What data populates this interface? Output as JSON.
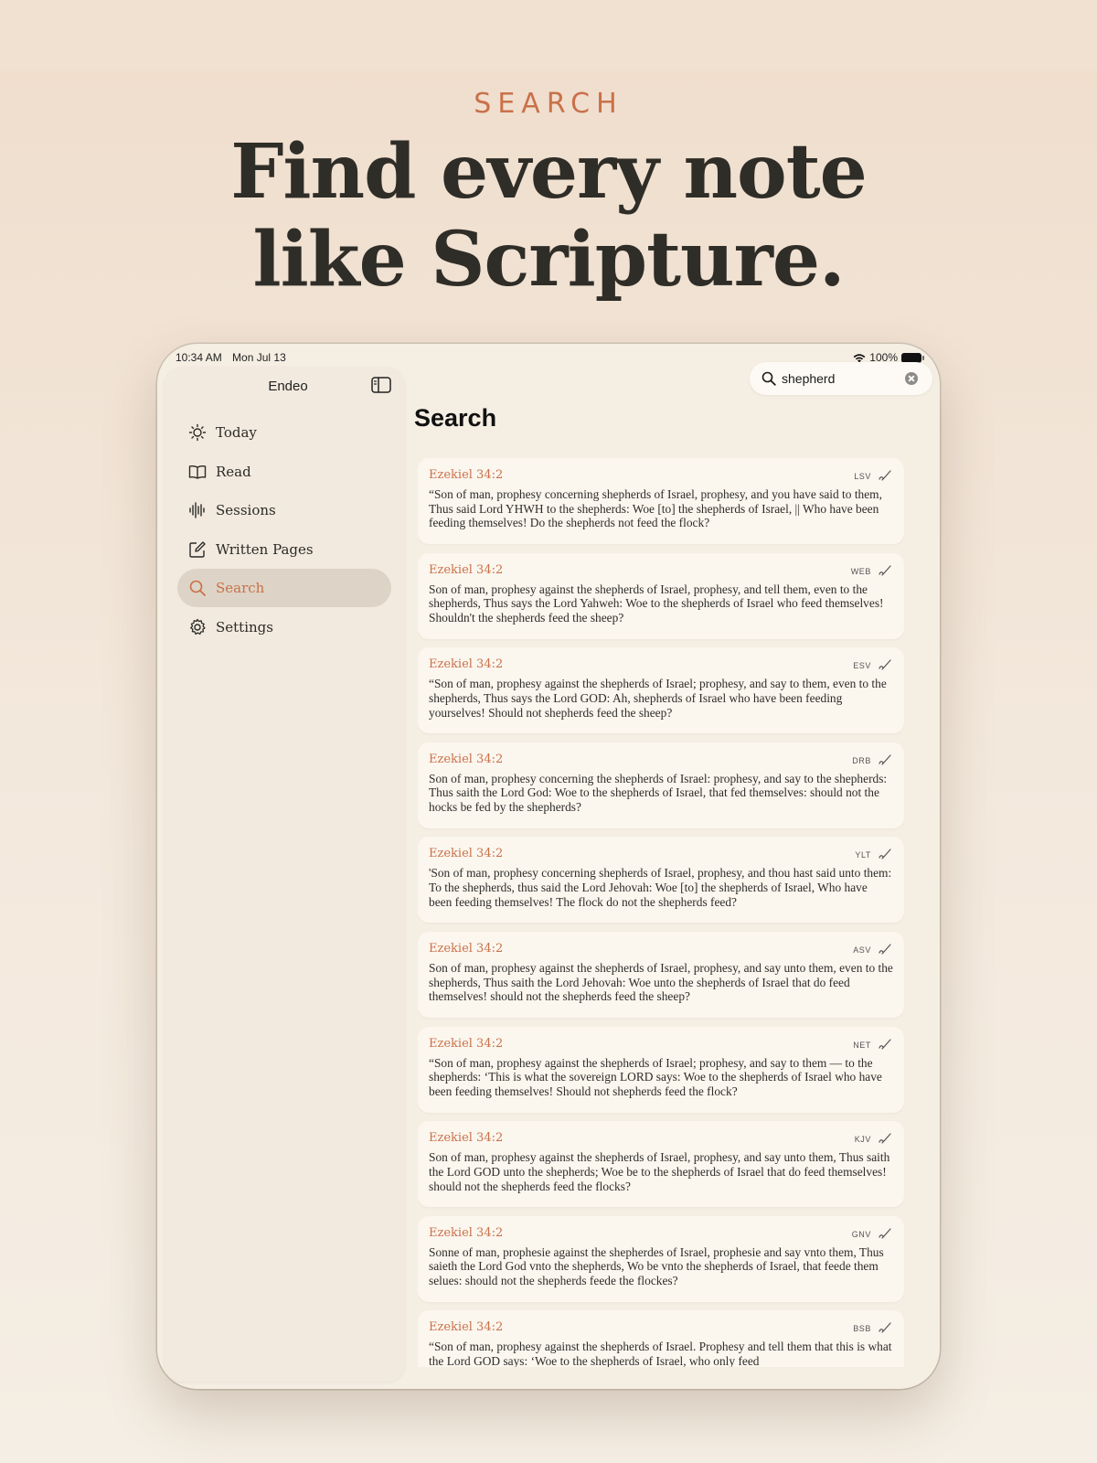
{
  "header": {
    "eyebrow": "SEARCH",
    "headline_line1": "Find every note",
    "headline_line2": "like Scripture."
  },
  "status_bar": {
    "time": "10:34 AM",
    "date": "Mon Jul 13",
    "battery": "100%"
  },
  "sidebar": {
    "app_title": "Endeo",
    "items": [
      {
        "label": "Today",
        "icon": "sun-icon"
      },
      {
        "label": "Read",
        "icon": "book-icon"
      },
      {
        "label": "Sessions",
        "icon": "waveform-icon"
      },
      {
        "label": "Written Pages",
        "icon": "compose-icon"
      },
      {
        "label": "Search",
        "icon": "search-icon",
        "active": true
      },
      {
        "label": "Settings",
        "icon": "gear-icon"
      }
    ]
  },
  "search": {
    "query": "shepherd",
    "placeholder": "Search"
  },
  "main": {
    "title": "Search"
  },
  "results": [
    {
      "reference": "Ezekiel 34:2",
      "version": "LSV",
      "text": "“Son of man, prophesy concerning shepherds of Israel, prophesy, and you have said to them, Thus said Lord YHWH to the shepherds: Woe [to] the shepherds of Israel, || Who have been feeding themselves! Do the shepherds not feed the flock?"
    },
    {
      "reference": "Ezekiel 34:2",
      "version": "WEB",
      "text": "Son of man, prophesy against the shepherds of Israel, prophesy, and tell them, even to the shepherds, Thus says the Lord Yahweh: Woe to the shepherds of Israel who feed themselves! Shouldn't the shepherds feed the sheep?"
    },
    {
      "reference": "Ezekiel 34:2",
      "version": "ESV",
      "text": "“Son of man, prophesy against the shepherds of Israel; prophesy, and say to them, even to the shepherds, Thus says the Lord GOD: Ah, shepherds of Israel who have been feeding yourselves! Should not shepherds feed the sheep?"
    },
    {
      "reference": "Ezekiel 34:2",
      "version": "DRB",
      "text": "Son of man, prophesy concerning the shepherds of Israel: prophesy, and say to the shepherds: Thus saith the Lord God: Woe to the shepherds of Israel, that fed themselves: should not the hocks be fed by the shepherds?"
    },
    {
      "reference": "Ezekiel 34:2",
      "version": "YLT",
      "text": "'Son of man, prophesy concerning shepherds of Israel, prophesy, and thou hast said unto them: To the shepherds, thus said the Lord Jehovah: Woe [to] the shepherds of Israel, Who have been feeding themselves! The flock do not the shepherds feed?"
    },
    {
      "reference": "Ezekiel 34:2",
      "version": "ASV",
      "text": "Son of man, prophesy against the shepherds of Israel, prophesy, and say unto them, even to the shepherds, Thus saith the Lord Jehovah: Woe unto the shepherds of Israel that do feed themselves! should not the shepherds feed the sheep?"
    },
    {
      "reference": "Ezekiel 34:2",
      "version": "NET",
      "text": "“Son of man, prophesy against the shepherds of Israel; prophesy, and say to them — to the shepherds: ‘This is what the sovereign LORD says: Woe to the shepherds of Israel who have been feeding themselves! Should not shepherds feed the flock?"
    },
    {
      "reference": "Ezekiel 34:2",
      "version": "KJV",
      "text": "Son of man, prophesy against the shepherds of Israel, prophesy, and say unto them, Thus saith the Lord GOD unto the shepherds; Woe be to the shepherds of Israel that do feed themselves! should not the shepherds feed the flocks?"
    },
    {
      "reference": "Ezekiel 34:2",
      "version": "GNV",
      "text": "Sonne of man, prophesie against the shepherdes of Israel, prophesie and say vnto them, Thus saieth the Lord God vnto the shepherds, Wo be vnto the shepherds of Israel, that feede them selues: should not the shepherds feede the flockes?"
    },
    {
      "reference": "Ezekiel 34:2",
      "version": "BSB",
      "text": "“Son of man, prophesy against the shepherds of Israel. Prophesy and tell them that this is what the Lord GOD says: ‘Woe to the shepherds of Israel, who only feed"
    }
  ],
  "colors": {
    "accent": "#c9714a",
    "text": "#2f2d27",
    "card": "#fbf6ee",
    "sidebar": "#f2eadf",
    "active_row": "#ddd4c7"
  }
}
